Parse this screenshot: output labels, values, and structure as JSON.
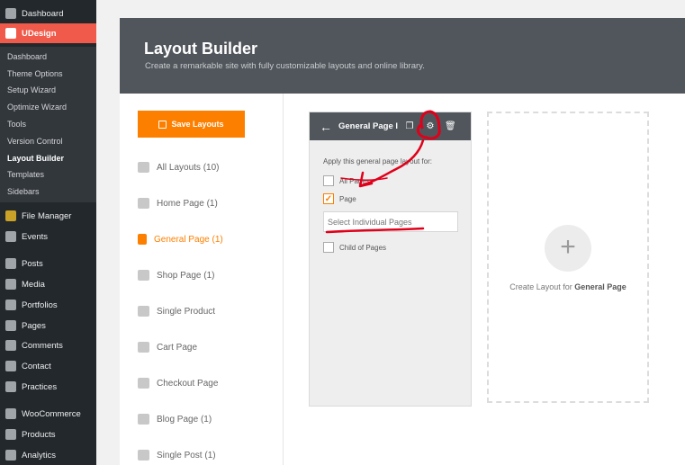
{
  "sidebar": {
    "top_items": [
      {
        "label": "Dashboard",
        "icon": "dashboard-icon"
      },
      {
        "label": "UDesign",
        "icon": "udesign-logo-icon"
      }
    ],
    "submenu": [
      {
        "label": "Dashboard"
      },
      {
        "label": "Theme Options"
      },
      {
        "label": "Setup Wizard"
      },
      {
        "label": "Optimize Wizard"
      },
      {
        "label": "Tools"
      },
      {
        "label": "Version Control"
      },
      {
        "label": "Layout Builder",
        "active": true
      },
      {
        "label": "Templates"
      },
      {
        "label": "Sidebars"
      }
    ],
    "items": [
      {
        "label": "File Manager",
        "icon": "folder-icon"
      },
      {
        "label": "Events",
        "icon": "events-icon"
      },
      {
        "label": "Posts",
        "icon": "pin-icon"
      },
      {
        "label": "Media",
        "icon": "media-icon"
      },
      {
        "label": "Portfolios",
        "icon": "portfolio-icon"
      },
      {
        "label": "Pages",
        "icon": "pages-icon"
      },
      {
        "label": "Comments",
        "icon": "comment-icon"
      },
      {
        "label": "Contact",
        "icon": "mail-icon"
      },
      {
        "label": "Practices",
        "icon": "gear-icon"
      },
      {
        "label": "WooCommerce",
        "icon": "woo-icon"
      },
      {
        "label": "Products",
        "icon": "products-icon"
      },
      {
        "label": "Analytics",
        "icon": "analytics-icon"
      }
    ]
  },
  "header": {
    "title": "Layout Builder",
    "subtitle": "Create a remarkable site with fully customizable layouts and online library."
  },
  "save_button": "Save Layouts",
  "layout_list": [
    {
      "label": "All Layouts",
      "count": "(10)",
      "icon": "layers-icon"
    },
    {
      "label": "Home Page",
      "count": "(1)",
      "icon": "home-icon"
    },
    {
      "label": "General Page",
      "count": "(1)",
      "icon": "page-icon",
      "active": true
    },
    {
      "label": "Shop Page",
      "count": "(1)",
      "icon": "shop-icon"
    },
    {
      "label": "Single Product",
      "count": "",
      "icon": "cart-icon"
    },
    {
      "label": "Cart Page",
      "count": "",
      "icon": "calendar-icon"
    },
    {
      "label": "Checkout Page",
      "count": "",
      "icon": "calendar-icon"
    },
    {
      "label": "Blog Page",
      "count": "(1)",
      "icon": "calendar-icon"
    },
    {
      "label": "Single Post",
      "count": "(1)",
      "icon": "calendar-check-icon"
    }
  ],
  "card": {
    "title": "General Page l",
    "apply_text": "Apply this general page layout for:",
    "options": [
      {
        "label": "All Pages",
        "checked": false
      },
      {
        "label": "Page",
        "checked": true
      }
    ],
    "search_placeholder": "Select Individual Pages",
    "child_option": {
      "label": "Child of Pages",
      "checked": false
    }
  },
  "create": {
    "prefix": "Create Layout for ",
    "bold": "General Page"
  },
  "colors": {
    "accent": "#fd7f00",
    "annotation": "#e0001a",
    "header": "#51565c",
    "udesign": "#f05a4a"
  }
}
